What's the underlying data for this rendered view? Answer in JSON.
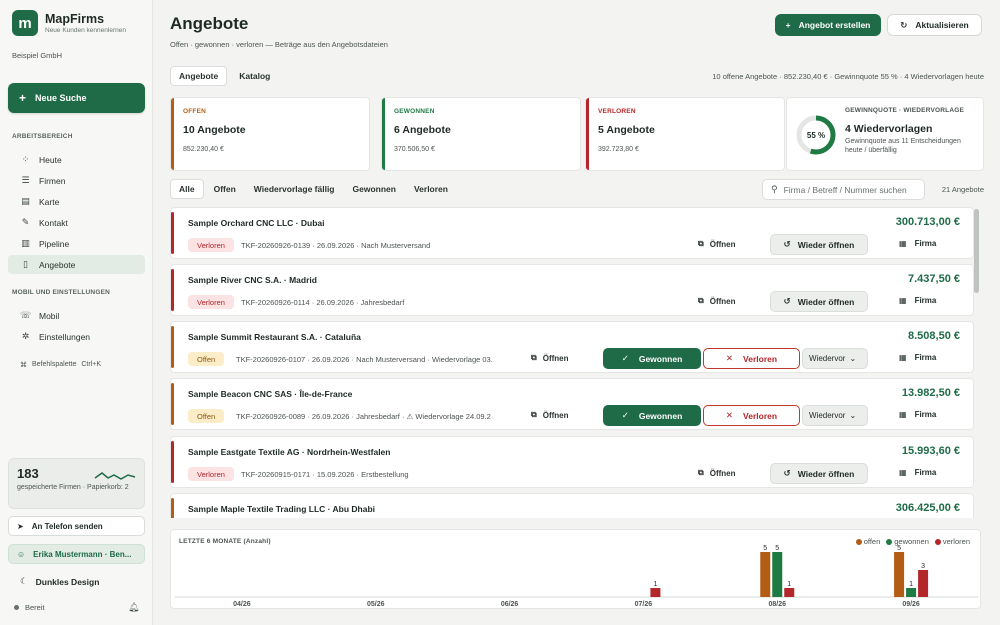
{
  "app": {
    "name": "MapFirms",
    "tagline": "Neue Kunden kennenlernen",
    "company": "Beispiel GmbH"
  },
  "sidebar": {
    "new_search": "Neue Suche",
    "section_work": "ARBEITSBEREICH",
    "items": [
      {
        "label": "Heute",
        "icon": "grid-icon"
      },
      {
        "label": "Firmen",
        "icon": "database-icon"
      },
      {
        "label": "Karte",
        "icon": "map-icon"
      },
      {
        "label": "Kontakt",
        "icon": "contact-icon"
      },
      {
        "label": "Pipeline",
        "icon": "pipeline-icon"
      },
      {
        "label": "Angebote",
        "icon": "document-icon",
        "active": true
      }
    ],
    "section_mobile": "MOBIL UND EINSTELLUNGEN",
    "items2": [
      {
        "label": "Mobil",
        "icon": "phone-icon"
      },
      {
        "label": "Einstellungen",
        "icon": "gear-icon"
      }
    ],
    "palette_label": "Befehlspalette",
    "palette_shortcut": "Ctrl+K",
    "stats": {
      "count": "183",
      "text": "gespeicherte Firmen · Papierkorb: 2"
    },
    "send_phone": "An Telefon senden",
    "user": "Erika Mustermann · Ben...",
    "dark_mode": "Dunkles Design",
    "status": "Bereit"
  },
  "header": {
    "title": "Angebote",
    "subtitle": "Offen · gewonnen · verloren — Beträge aus den Angebotsdateien",
    "create_button": "Angebot erstellen",
    "refresh_button": "Aktualisieren"
  },
  "tabs": [
    "Angebote",
    "Katalog"
  ],
  "summary_line": "10 offene Angebote · 852.230,40 € · Gewinnquote 55 % · 4 Wiedervorlagen heute",
  "kpis": [
    {
      "label": "OFFEN",
      "value": "10 Angebote",
      "sum": "852.230,40 €",
      "color": "#b35d14"
    },
    {
      "label": "GEWONNEN",
      "value": "6 Angebote",
      "sum": "370.506,50 €",
      "color": "#1f7a44"
    },
    {
      "label": "VERLOREN",
      "value": "5 Angebote",
      "sum": "392.723,80 €",
      "color": "#b3262a"
    }
  ],
  "quote": {
    "label": "GEWINNQUOTE · WIEDERVORLAGE",
    "percent_text": "55 %",
    "percent": 55,
    "value": "4 Wiedervorlagen",
    "sub1": "Gewinnquote aus 11 Entscheidungen",
    "sub2": "heute / überfällig"
  },
  "filters": [
    "Alle",
    "Offen",
    "Wiedervorlage fällig",
    "Gewonnen",
    "Verloren"
  ],
  "search_placeholder": "Firma / Betreff / Nummer suchen",
  "result_count": "21 Angebote",
  "labels": {
    "open_doc": "Öffnen",
    "reopen": "Wieder öffnen",
    "won": "Gewonnen",
    "lost": "Verloren",
    "followup": "Wiedervor",
    "company": "Firma"
  },
  "rows": [
    {
      "title": "Sample Orchard CNC LLC · Dubai",
      "amount": "300.713,00 €",
      "status": "Verloren",
      "meta": "TKF-20260926-0139 · 26.09.2026 · Nach Musterversand"
    },
    {
      "title": "Sample River CNC S.A. · Madrid",
      "amount": "7.437,50 €",
      "status": "Verloren",
      "meta": "TKF-20260926-0114 · 26.09.2026 · Jahresbedarf"
    },
    {
      "title": "Sample Summit Restaurant S.A. · Cataluña",
      "amount": "8.508,50 €",
      "status": "Offen",
      "meta": "TKF-20260926-0107 · 26.09.2026 · Nach Musterversand · Wiedervorlage 03."
    },
    {
      "title": "Sample Beacon CNC SAS · Île-de-France",
      "amount": "13.982,50 €",
      "status": "Offen",
      "meta": "TKF-20260926-0089 · 26.09.2026 · Jahresbedarf · ⚠ Wiedervorlage 24.09.2"
    },
    {
      "title": "Sample Eastgate Textile AG · Nordrhein-Westfalen",
      "amount": "15.993,60 €",
      "status": "Verloren",
      "meta": "TKF-20260915-0171 · 15.09.2026 · Erstbestellung"
    },
    {
      "title": "Sample Maple Textile Trading LLC · Abu Dhabi",
      "amount": "306.425,00 €",
      "status": "",
      "meta": ""
    }
  ],
  "colors": {
    "open": "#b35d14",
    "won": "#1f7a44",
    "lost": "#b3262a",
    "accent": "#1f6b48"
  },
  "chart_data": {
    "type": "bar",
    "title": "LETZTE 6 MONATE (Anzahl)",
    "categories": [
      "04/26",
      "05/26",
      "06/26",
      "07/26",
      "08/26",
      "09/26"
    ],
    "series": [
      {
        "name": "offen",
        "color": "#b35d14",
        "values": [
          0,
          0,
          0,
          0,
          5,
          5
        ]
      },
      {
        "name": "gewonnen",
        "color": "#1f7a44",
        "values": [
          0,
          0,
          0,
          0,
          5,
          1
        ]
      },
      {
        "name": "verloren",
        "color": "#b3262a",
        "values": [
          0,
          0,
          0,
          1,
          1,
          3
        ]
      }
    ],
    "ylim": [
      0,
      5
    ],
    "legend": "top-right"
  }
}
